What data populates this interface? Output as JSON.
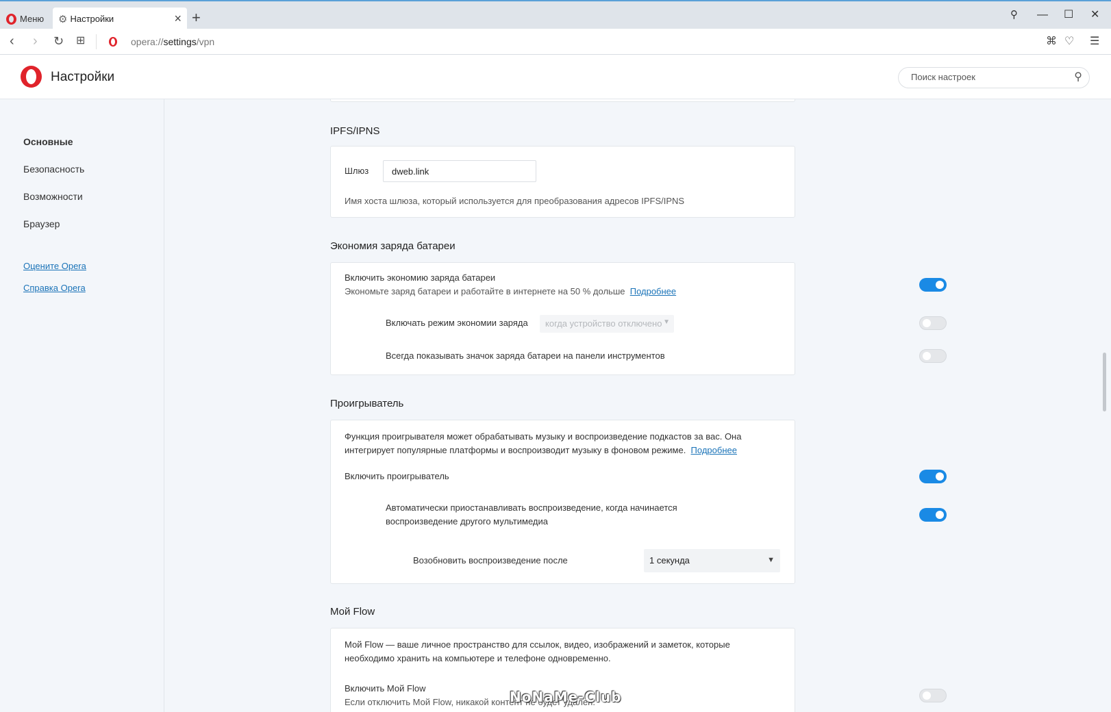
{
  "tabs": {
    "menu_label": "Меню",
    "active_label": "Настройки"
  },
  "addressbar": {
    "url_scheme": "opera://",
    "url_path": "settings",
    "url_rest": "/vpn"
  },
  "header": {
    "title": "Настройки",
    "search_placeholder": "Поиск настроек"
  },
  "sidebar": {
    "items": [
      {
        "label": "Основные",
        "active": true
      },
      {
        "label": "Безопасность",
        "active": false
      },
      {
        "label": "Возможности",
        "active": false
      },
      {
        "label": "Браузер",
        "active": false
      }
    ],
    "links": [
      {
        "label": "Оцените Opera"
      },
      {
        "label": "Справка Opera"
      }
    ]
  },
  "ipfs": {
    "title": "IPFS/IPNS",
    "gateway_label": "Шлюз",
    "gateway_value": "dweb.link",
    "gateway_desc": "Имя хоста шлюза, который используется для преобразования адресов IPFS/IPNS"
  },
  "battery": {
    "title": "Экономия заряда батареи",
    "enable_label": "Включить экономию заряда батареи",
    "enable_desc": "Экономьте заряд батареи и работайте в интернете на 50 % дольше",
    "more_link": "Подробнее",
    "enable_on": true,
    "mode_label": "Включать режим экономии заряда",
    "mode_value": "когда устройство отключено",
    "mode_on": false,
    "icon_label": "Всегда показывать значок заряда батареи на панели инструментов",
    "icon_on": false
  },
  "player": {
    "title": "Проигрыватель",
    "desc_line1": "Функция проигрывателя может обрабатывать музыку и воспроизведение подкастов за вас. Она",
    "desc_line2": "интегрирует популярные платформы и воспроизводит музыку в фоновом режиме.",
    "more_link": "Подробнее",
    "enable_label": "Включить проигрыватель",
    "enable_on": true,
    "autopause_line1": "Автоматически приостанавливать воспроизведение, когда начинается",
    "autopause_line2": "воспроизведение другого мультимедиа",
    "autopause_on": true,
    "resume_label": "Возобновить воспроизведение после",
    "resume_value": "1 секунда"
  },
  "flow": {
    "title": "Мой Flow",
    "desc_line1": "Мой Flow — ваше личное пространство для ссылок, видео, изображений и заметок, которые",
    "desc_line2": "необходимо хранить на компьютере и телефоне одновременно.",
    "enable_label": "Включить Мой Flow",
    "enable_desc": "Если отключить Мой Flow, никакой контент не будет удален.",
    "enable_on": false
  },
  "watermark": "NoNaMe-Club"
}
